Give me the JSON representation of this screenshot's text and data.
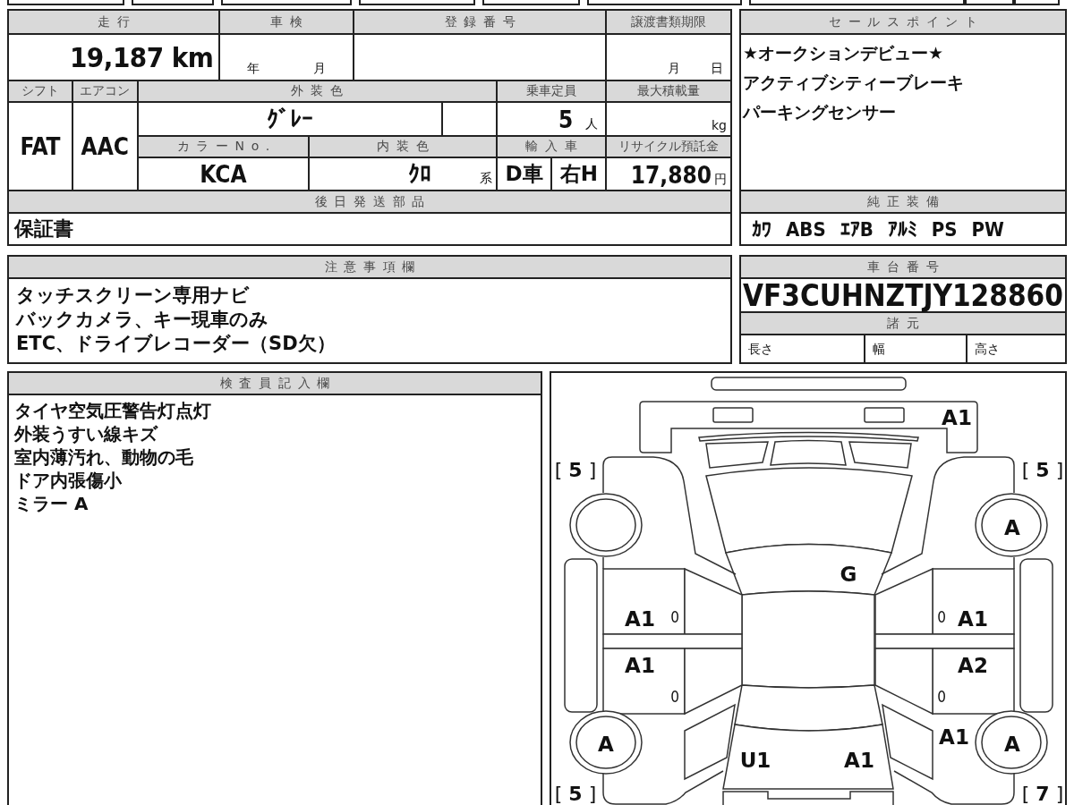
{
  "vehicle_table": {
    "mileage": {
      "label": "走行",
      "value": "19,187 km"
    },
    "inspection": {
      "label": "車検",
      "year_unit": "年",
      "month_unit": "月"
    },
    "registration_number": {
      "label": "登録番号"
    },
    "transfer_deadline": {
      "label": "譲渡書類期限",
      "month_unit": "月",
      "day_unit": "日"
    },
    "shift": {
      "label": "シフト",
      "value": "FAT"
    },
    "aircon": {
      "label": "エアコン",
      "value": "AAC"
    },
    "exterior_color": {
      "label": "外装色",
      "value": "ｸﾞﾚｰ"
    },
    "capacity": {
      "label": "乗車定員",
      "value": "5",
      "unit": "人"
    },
    "max_load": {
      "label": "最大積載量",
      "unit": "kg"
    },
    "color_no": {
      "label": "カラーNo.",
      "value": "KCA"
    },
    "interior_color": {
      "label": "内装色",
      "value": "ｸﾛ",
      "suffix": "系"
    },
    "import": {
      "label": "輸入車",
      "dealer": "D車",
      "handle": "右H"
    },
    "recycle_deposit": {
      "label": "リサイクル預託金",
      "value": "17,880",
      "unit": "円"
    },
    "parts_to_ship": {
      "label": "後日発送部品",
      "value": "保証書"
    }
  },
  "sale_points": {
    "label": "セールスポイント",
    "lines": [
      "★オークションデビュー★",
      "アクティブシティーブレーキ",
      "パーキングセンサー"
    ]
  },
  "standard_equipment": {
    "label": "純正装備",
    "items": [
      "ｶﾜ",
      "ABS",
      "ｴｱB",
      "ｱﾙﾐ",
      "PS",
      "PW"
    ]
  },
  "notes": {
    "label": "注意事項欄",
    "lines": [
      "タッチスクリーン専用ナビ",
      "バックカメラ、キー現車のみ",
      "ETC、ドライブレコーダー（SD欠）"
    ]
  },
  "chassis": {
    "label": "車台番号",
    "value": "VF3CUHNZTJY128860"
  },
  "specs": {
    "label": "諸元",
    "fields": [
      "長さ",
      "幅",
      "高さ"
    ]
  },
  "inspector": {
    "label": "検査員記入欄",
    "lines": [
      "タイヤ空気圧警告灯点灯",
      "外装うすい線キズ",
      "室内薄汚れ、動物の毛",
      "ドア内張傷小",
      "ミラー A"
    ]
  },
  "condition_diagram": {
    "tread": {
      "front_left": "[ **5** ]",
      "front_right": "[ **5** ]",
      "rear_left": "[ **5** ]",
      "rear_right": "[ **7** ]"
    },
    "marks": {
      "front_bumper": {
        "kind": "grade",
        "text": "A1"
      },
      "right_front_tire": {
        "kind": "grade",
        "text": "A"
      },
      "windshield": {
        "kind": "grade",
        "text": "G"
      },
      "left_front_door": {
        "kind": "grade",
        "text": "A1"
      },
      "left_front_door_gauge": {
        "kind": "gauge",
        "text": "0"
      },
      "right_front_door_gauge": {
        "kind": "gauge",
        "text": "0"
      },
      "right_front_door": {
        "kind": "grade",
        "text": "A1"
      },
      "left_rear_door": {
        "kind": "grade",
        "text": "A1"
      },
      "right_rear_door": {
        "kind": "grade",
        "text": "A2"
      },
      "left_rear_door_gauge": {
        "kind": "gauge",
        "text": "0"
      },
      "right_rear_door_gauge": {
        "kind": "gauge",
        "text": "0"
      },
      "right_rear_quarter": {
        "kind": "grade",
        "text": "A1"
      },
      "left_rear_tire": {
        "kind": "grade",
        "text": "A"
      },
      "right_rear_tire": {
        "kind": "grade",
        "text": "A"
      },
      "trunk_left": {
        "kind": "grade",
        "text": "U1"
      },
      "trunk_right": {
        "kind": "grade",
        "text": "A1"
      }
    }
  }
}
